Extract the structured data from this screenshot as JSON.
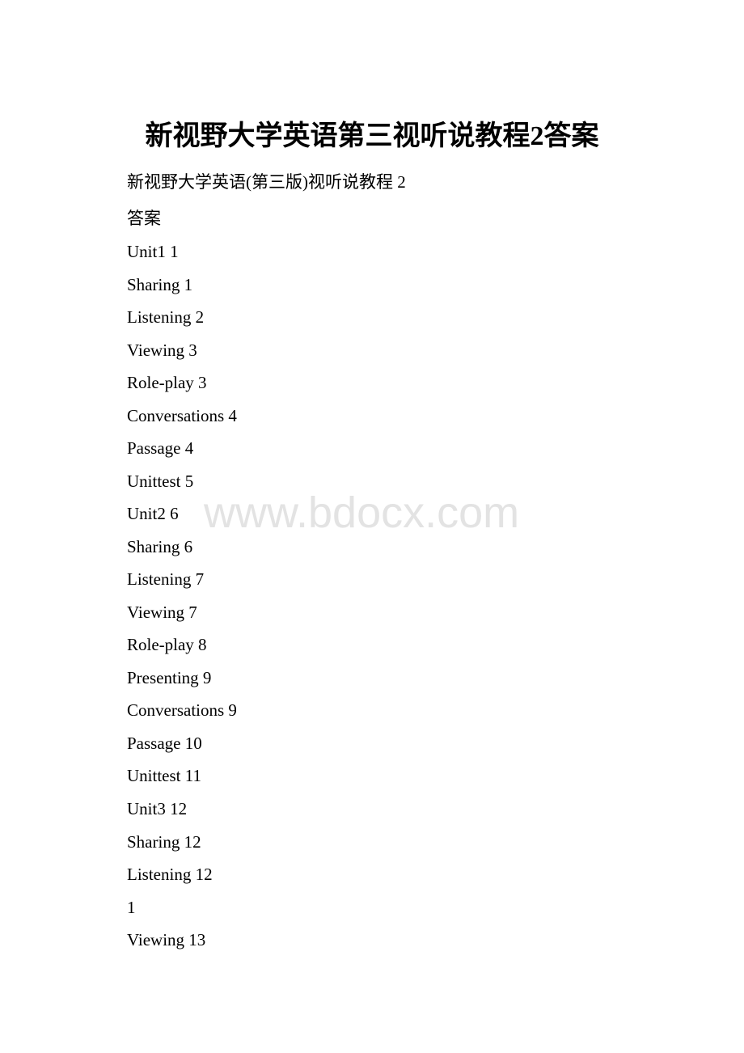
{
  "document": {
    "title": "新视野大学英语第三视听说教程2答案",
    "subtitle": "新视野大学英语(第三版)视听说教程 2",
    "subtitle2": "答案",
    "watermark": "www.bdocx.com",
    "toc": [
      {
        "text": "Unit1 1"
      },
      {
        "text": "Sharing 1"
      },
      {
        "text": "Listening 2"
      },
      {
        "text": "Viewing 3"
      },
      {
        "text": "Role-play 3"
      },
      {
        "text": "Conversations 4"
      },
      {
        "text": "Passage 4"
      },
      {
        "text": "Unittest 5"
      },
      {
        "text": "Unit2 6"
      },
      {
        "text": "Sharing 6"
      },
      {
        "text": "Listening 7"
      },
      {
        "text": "Viewing 7"
      },
      {
        "text": "Role-play 8"
      },
      {
        "text": "Presenting 9"
      },
      {
        "text": "Conversations 9"
      },
      {
        "text": "Passage 10"
      },
      {
        "text": "Unittest 11"
      },
      {
        "text": "Unit3 12"
      },
      {
        "text": "Sharing 12"
      },
      {
        "text": "Listening 12"
      },
      {
        "text": "1"
      },
      {
        "text": "Viewing 13"
      }
    ]
  }
}
